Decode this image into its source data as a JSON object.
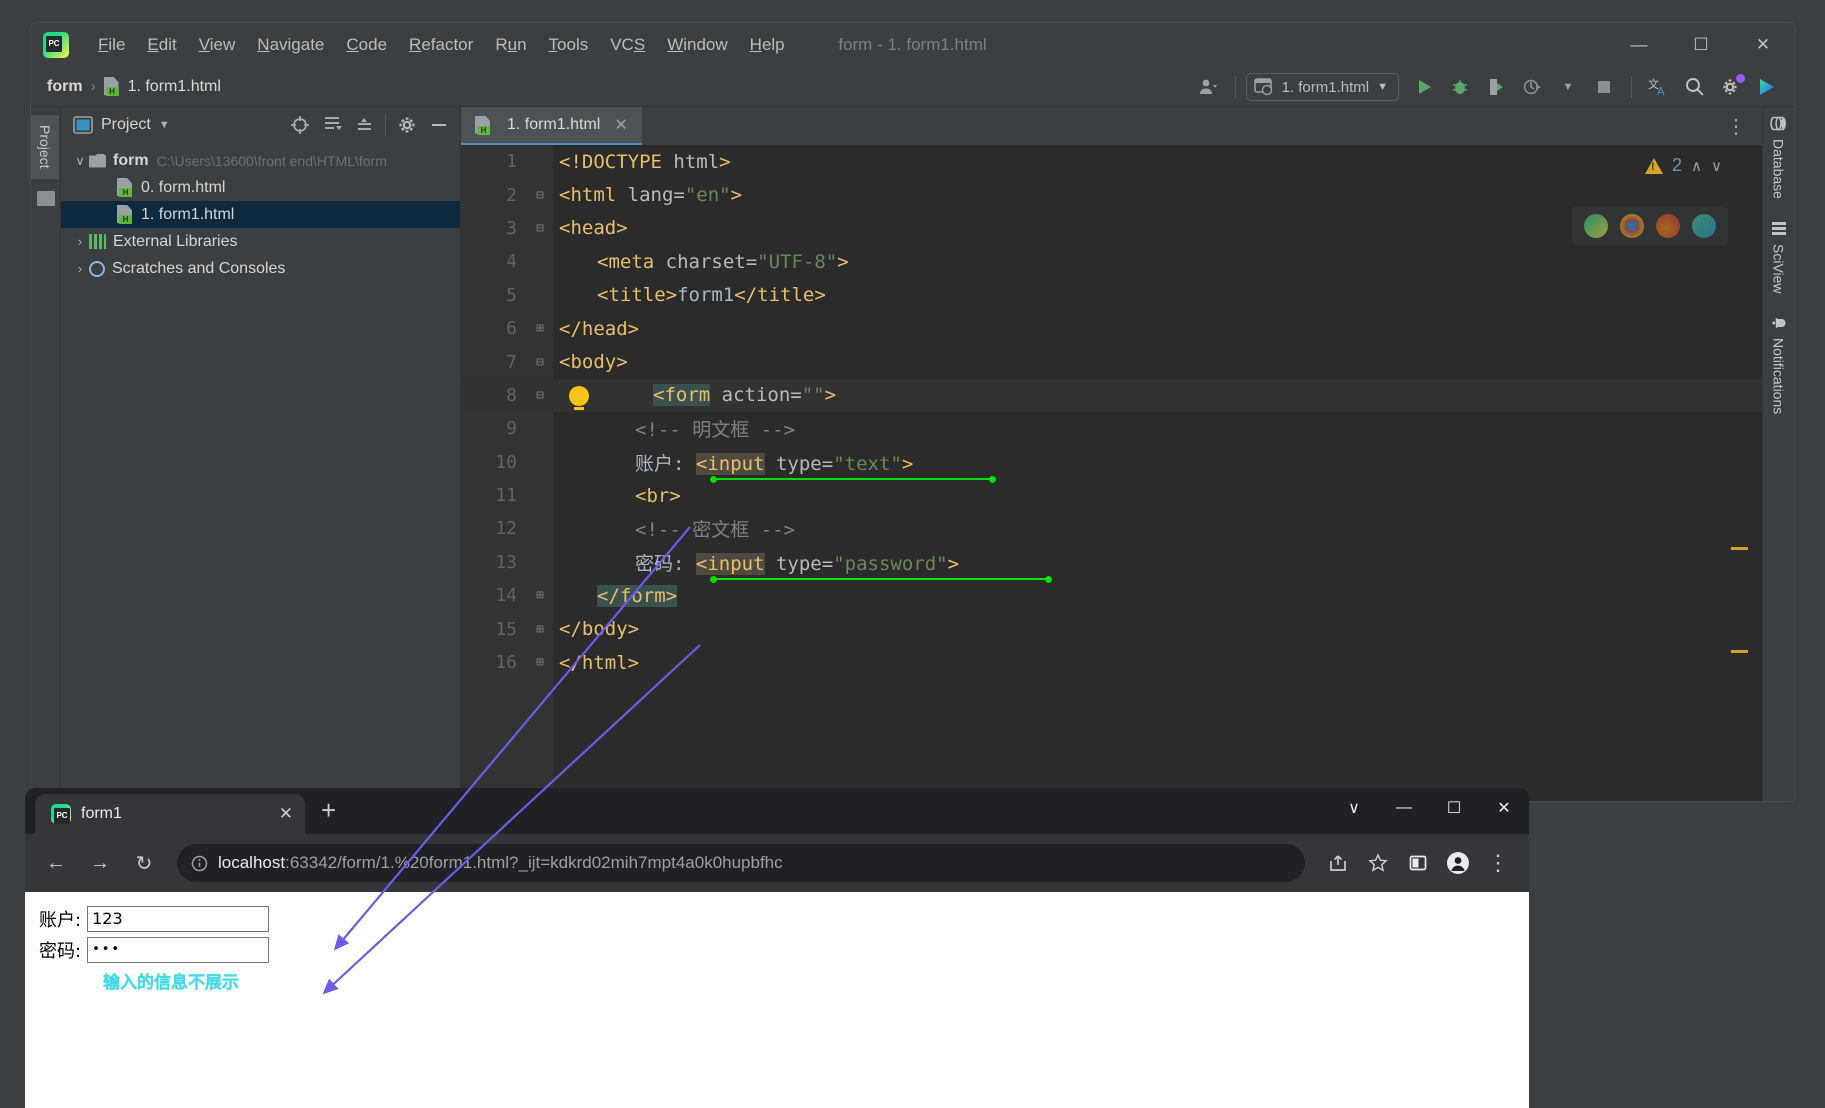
{
  "ide": {
    "window_title": "form - 1. form1.html",
    "menu": [
      "File",
      "Edit",
      "View",
      "Navigate",
      "Code",
      "Refactor",
      "Run",
      "Tools",
      "VCS",
      "Window",
      "Help"
    ],
    "window_controls": {
      "minimize": "—",
      "maximize": "☐",
      "close": "✕"
    },
    "breadcrumb": {
      "project": "form",
      "separator": "›",
      "file": "1. form1.html"
    },
    "run_config": {
      "label": "1. form1.html",
      "chevron": "▼"
    },
    "toolbar_icons": [
      "run-icon",
      "debug-icon",
      "run-coverage-icon",
      "profile-icon",
      "stop-icon",
      "translate-icon",
      "search-icon",
      "settings-icon",
      "ai-assistant-icon"
    ],
    "account_icon": "user-account-icon",
    "left_rail_tab": "Project",
    "project_panel": {
      "title": "Project",
      "dropdown": "▼",
      "header_icons": [
        "locate-icon",
        "expand-all-icon",
        "collapse-all-icon",
        "settings-icon",
        "hide-icon"
      ],
      "tree": [
        {
          "label": "form",
          "path": "C:\\Users\\13600\\front end\\HTML\\form",
          "icon": "folder-icon",
          "chevron": "∨",
          "selected": false,
          "indent": 0
        },
        {
          "label": "0. form.html",
          "path": "",
          "icon": "html-file-icon",
          "chevron": "",
          "selected": false,
          "indent": 1
        },
        {
          "label": "1. form1.html",
          "path": "",
          "icon": "html-file-icon",
          "chevron": "",
          "selected": true,
          "indent": 1
        },
        {
          "label": "External Libraries",
          "path": "",
          "icon": "library-icon",
          "chevron": "›",
          "selected": false,
          "indent": 0
        },
        {
          "label": "Scratches and Consoles",
          "path": "",
          "icon": "scratches-icon",
          "chevron": "›",
          "selected": false,
          "indent": 0
        }
      ]
    },
    "editor": {
      "tab_label": "1. form1.html",
      "tab_close": "✕",
      "more_menu": "⋮",
      "warning_count": "2",
      "warning_up": "∧",
      "warning_down": "∨",
      "lines": [
        {
          "n": "1",
          "indent": 0,
          "fold": "",
          "bulb": false,
          "tokens": [
            {
              "t": "tag",
              "s": "<!DOCTYPE"
            },
            {
              "t": "txt",
              "s": " "
            },
            {
              "t": "attr",
              "s": "html"
            },
            {
              "t": "tag",
              "s": ">"
            }
          ]
        },
        {
          "n": "2",
          "indent": 0,
          "fold": "⊟",
          "bulb": false,
          "tokens": [
            {
              "t": "tag",
              "s": "<html"
            },
            {
              "t": "txt",
              "s": " "
            },
            {
              "t": "attr",
              "s": "lang="
            },
            {
              "t": "str",
              "s": "\"en\""
            },
            {
              "t": "tag",
              "s": ">"
            }
          ]
        },
        {
          "n": "3",
          "indent": 0,
          "fold": "⊟",
          "bulb": false,
          "tokens": [
            {
              "t": "tag",
              "s": "<head>"
            }
          ]
        },
        {
          "n": "4",
          "indent": 1,
          "fold": "",
          "bulb": false,
          "tokens": [
            {
              "t": "tag",
              "s": "<meta"
            },
            {
              "t": "txt",
              "s": " "
            },
            {
              "t": "attr",
              "s": "charset="
            },
            {
              "t": "str",
              "s": "\"UTF-8\""
            },
            {
              "t": "tag",
              "s": ">"
            }
          ]
        },
        {
          "n": "5",
          "indent": 1,
          "fold": "",
          "bulb": false,
          "tokens": [
            {
              "t": "tag",
              "s": "<title>"
            },
            {
              "t": "txt",
              "s": "form1"
            },
            {
              "t": "tag",
              "s": "</title>"
            }
          ]
        },
        {
          "n": "6",
          "indent": 0,
          "fold": "⊞",
          "bulb": false,
          "tokens": [
            {
              "t": "tag",
              "s": "</head>"
            }
          ]
        },
        {
          "n": "7",
          "indent": 0,
          "fold": "⊟",
          "bulb": false,
          "tokens": [
            {
              "t": "tag",
              "s": "<body>"
            }
          ]
        },
        {
          "n": "8",
          "indent": 1,
          "fold": "⊟",
          "bulb": true,
          "hl": true,
          "tokens": [
            {
              "t": "tag hl-form",
              "s": "<form"
            },
            {
              "t": "txt",
              "s": " "
            },
            {
              "t": "attr",
              "s": "action="
            },
            {
              "t": "str",
              "s": "\"\""
            },
            {
              "t": "tag",
              "s": ">"
            }
          ]
        },
        {
          "n": "9",
          "indent": 2,
          "fold": "",
          "bulb": false,
          "tokens": [
            {
              "t": "com",
              "s": "<!-- 明文框 -->"
            }
          ]
        },
        {
          "n": "10",
          "indent": 2,
          "fold": "",
          "bulb": false,
          "underline": "u1",
          "tokens": [
            {
              "t": "txt",
              "s": "账户: "
            },
            {
              "t": "tag hl-inp",
              "s": "<input"
            },
            {
              "t": "txt",
              "s": " "
            },
            {
              "t": "attr",
              "s": "type="
            },
            {
              "t": "str",
              "s": "\"text\""
            },
            {
              "t": "tag",
              "s": ">"
            }
          ]
        },
        {
          "n": "11",
          "indent": 2,
          "fold": "",
          "bulb": false,
          "tokens": [
            {
              "t": "tag",
              "s": "<br>"
            }
          ]
        },
        {
          "n": "12",
          "indent": 2,
          "fold": "",
          "bulb": false,
          "tokens": [
            {
              "t": "com",
              "s": "<!-- 密文框 -->"
            }
          ]
        },
        {
          "n": "13",
          "indent": 2,
          "fold": "",
          "bulb": false,
          "underline": "u2",
          "tokens": [
            {
              "t": "txt",
              "s": "密码: "
            },
            {
              "t": "tag hl-inp",
              "s": "<input"
            },
            {
              "t": "txt",
              "s": " "
            },
            {
              "t": "attr",
              "s": "type="
            },
            {
              "t": "str",
              "s": "\"password\""
            },
            {
              "t": "tag",
              "s": ">"
            }
          ]
        },
        {
          "n": "14",
          "indent": 1,
          "fold": "⊞",
          "bulb": false,
          "tokens": [
            {
              "t": "tag hl-form",
              "s": "</form>"
            }
          ]
        },
        {
          "n": "15",
          "indent": 0,
          "fold": "⊞",
          "bulb": false,
          "tokens": [
            {
              "t": "tag",
              "s": "</body>"
            }
          ]
        },
        {
          "n": "16",
          "indent": 0,
          "fold": "⊞",
          "bulb": false,
          "tokens": [
            {
              "t": "tag",
              "s": "</html>"
            }
          ]
        }
      ],
      "browser_pills": [
        "pycharm-preview-icon",
        "chrome-icon",
        "firefox-icon",
        "edge-icon"
      ]
    },
    "right_rail": [
      {
        "label": "Database",
        "icon": "database-icon"
      },
      {
        "label": "SciView",
        "icon": "sciview-icon"
      },
      {
        "label": "Notifications",
        "icon": "bell-icon"
      }
    ]
  },
  "browser": {
    "tab": {
      "title": "form1",
      "favicon": "pycharm-favicon",
      "close": "✕"
    },
    "new_tab": "+",
    "window_controls": {
      "more": "∨",
      "minimize": "—",
      "maximize": "☐",
      "close": "✕"
    },
    "nav": {
      "back": "←",
      "forward": "→",
      "reload": "↻"
    },
    "omnibox": {
      "info_icon": "site-info-icon",
      "host": "localhost",
      "rest": ":63342/form/1.%20form1.html?_ijt=kdkrd02mih7mpt4a0k0hupbfhc"
    },
    "nav_right_icons": [
      "share-icon",
      "bookmark-star-icon",
      "side-panel-icon",
      "profile-avatar-icon",
      "chrome-menu-icon"
    ],
    "page": {
      "fields": [
        {
          "label": "账户:",
          "value": "123",
          "type": "text"
        },
        {
          "label": "密码:",
          "value": "•••",
          "type": "password"
        }
      ],
      "annotation": "输入的信息不展示"
    }
  },
  "colors": {
    "accent_green": "#21d789",
    "warning": "#d6a528",
    "annotation_arrow": "#6b5ce7",
    "annotation_underline": "#00e000",
    "note_text": "#44d9e6",
    "selection": "#0d293e"
  }
}
